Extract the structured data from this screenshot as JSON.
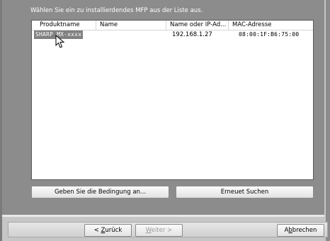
{
  "instruction": "Wählen Sie ein zu installierdendes MFP aus der Liste aus.",
  "table": {
    "columns": [
      "Produktname",
      "Name",
      "Name oder IP-Ad...",
      "MAC-Adresse"
    ],
    "rows": [
      {
        "product": "SHARP MX-xxxx",
        "name": "",
        "ip": "192.168.1.27",
        "mac": "08:00:1F:B6:75:00"
      }
    ]
  },
  "buttons": {
    "condition": "Geben Sie die Bedingung an...",
    "search": "Erneuet Suchen"
  },
  "nav": {
    "back": {
      "prefix": "< ",
      "accel": "Z",
      "rest": "urück"
    },
    "next": {
      "accel": "W",
      "rest": "eiter",
      "suffix": " >"
    },
    "cancel": {
      "prefix": "A",
      "accel": "b",
      "rest": "brechen"
    }
  },
  "colors": {
    "panel": "#8c8c8c",
    "selection": "#808080"
  }
}
